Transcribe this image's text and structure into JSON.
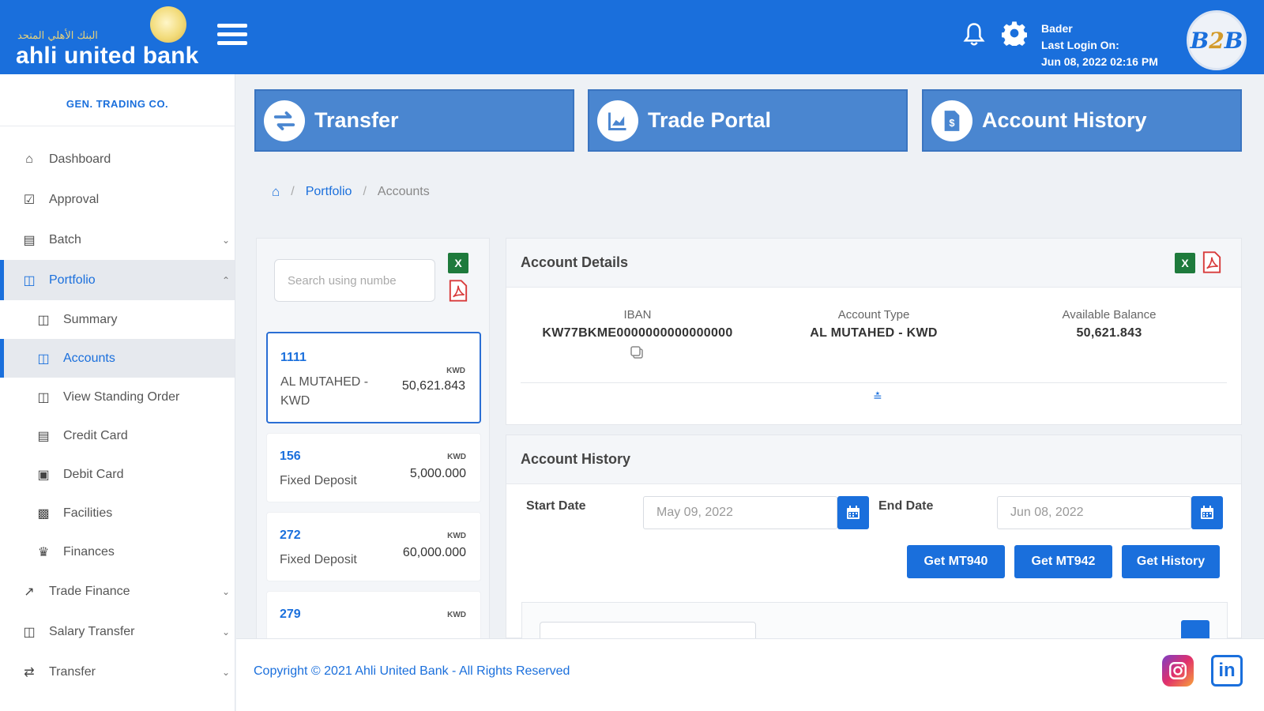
{
  "brand": {
    "arabic_name": "البنك الأهلي المتحد",
    "name": "ahli united bank"
  },
  "header": {
    "user_name": "Bader",
    "last_login_label": "Last Login On:",
    "last_login_time": "Jun 08, 2022 02:16 PM",
    "avatar_text_b1": "B",
    "avatar_text_2": "2",
    "avatar_text_b2": "B"
  },
  "sidebar": {
    "company": "GEN. TRADING CO.",
    "items": [
      {
        "label": "Dashboard",
        "icon": "home-icon"
      },
      {
        "label": "Approval",
        "icon": "check-square-icon"
      },
      {
        "label": "Batch",
        "icon": "batch-icon"
      },
      {
        "label": "Portfolio",
        "icon": "money-icon"
      },
      {
        "label": "Summary",
        "icon": "money-icon"
      },
      {
        "label": "Accounts",
        "icon": "money-icon"
      },
      {
        "label": "View Standing Order",
        "icon": "money-icon"
      },
      {
        "label": "Credit Card",
        "icon": "credit-card-icon"
      },
      {
        "label": "Debit Card",
        "icon": "debit-card-icon"
      },
      {
        "label": "Facilities",
        "icon": "document-icon"
      },
      {
        "label": "Finances",
        "icon": "bank-icon"
      },
      {
        "label": "Trade Finance",
        "icon": "chart-line-icon"
      },
      {
        "label": "Salary Transfer",
        "icon": "money-icon"
      },
      {
        "label": "Transfer",
        "icon": "exchange-icon"
      }
    ]
  },
  "actions": {
    "transfer": "Transfer",
    "trade_portal": "Trade Portal",
    "account_history": "Account History"
  },
  "breadcrumb": {
    "portfolio": "Portfolio",
    "accounts": "Accounts",
    "separator": "/"
  },
  "accounts_list": {
    "search_placeholder": "Search using numbe",
    "accounts": [
      {
        "number": "1111",
        "type": "AL MUTAHED - KWD",
        "currency": "KWD",
        "balance": "50,621.843"
      },
      {
        "number": "156",
        "type": "Fixed Deposit",
        "currency": "KWD",
        "balance": "5,000.000"
      },
      {
        "number": "272",
        "type": "Fixed Deposit",
        "currency": "KWD",
        "balance": "60,000.000"
      },
      {
        "number": "279",
        "type": "",
        "currency": "KWD",
        "balance": ""
      }
    ]
  },
  "account_details": {
    "title": "Account Details",
    "iban_label": "IBAN",
    "iban_value": "KW77BKME0000000000000000",
    "type_label": "Account Type",
    "type_value": "AL MUTAHED - KWD",
    "balance_label": "Available Balance",
    "balance_value": "50,621.843"
  },
  "account_history": {
    "title": "Account History",
    "start_label": "Start Date",
    "start_value": "May 09, 2022",
    "end_label": "End Date",
    "end_value": "Jun 08, 2022",
    "btn_mt940": "Get MT940",
    "btn_mt942": "Get MT942",
    "btn_history": "Get History"
  },
  "footer": {
    "copyright": "Copyright © 2021 Ahli United Bank - All Rights Reserved",
    "linkedin": "in"
  },
  "colors": {
    "primary": "#1a6fdc",
    "header_button": "#4a86d0",
    "excel": "#1e7a3c",
    "pdf": "#d83b3b"
  }
}
